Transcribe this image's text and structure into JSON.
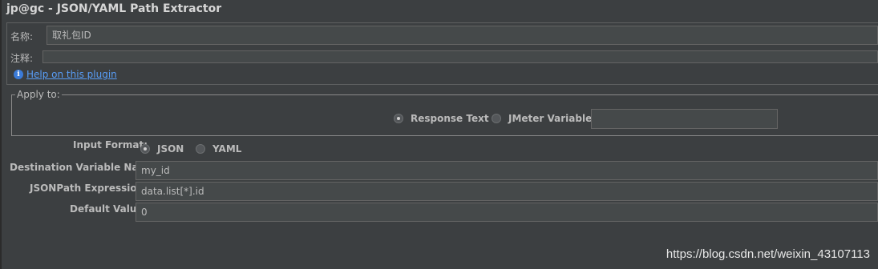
{
  "title": "jp@gc - JSON/YAML Path Extractor",
  "name_label": "名称:",
  "name_value": "取礼包ID",
  "comment_label": "注释:",
  "comment_value": "",
  "help_link": "Help on this plugin",
  "apply_to": {
    "title": "Apply to:",
    "options": [
      "Response Text",
      "JMeter Variable:"
    ],
    "selected": "Response Text",
    "jmeter_variable_value": ""
  },
  "input_format": {
    "label": "Input Format:",
    "options": [
      "JSON",
      "YAML"
    ],
    "selected": "JSON"
  },
  "destination": {
    "label": "Destination Variable Name:",
    "value": "my_id"
  },
  "jsonpath": {
    "label": "JSONPath Expression:",
    "value": "data.list[*].id"
  },
  "default_value": {
    "label": "Default Value:",
    "value": "0"
  },
  "watermark": "https://blog.csdn.net/weixin_43107113",
  "icons": {
    "info": "info-icon"
  },
  "colors": {
    "background": "#3c3f41",
    "link": "#589df6",
    "field": "#45494a"
  }
}
